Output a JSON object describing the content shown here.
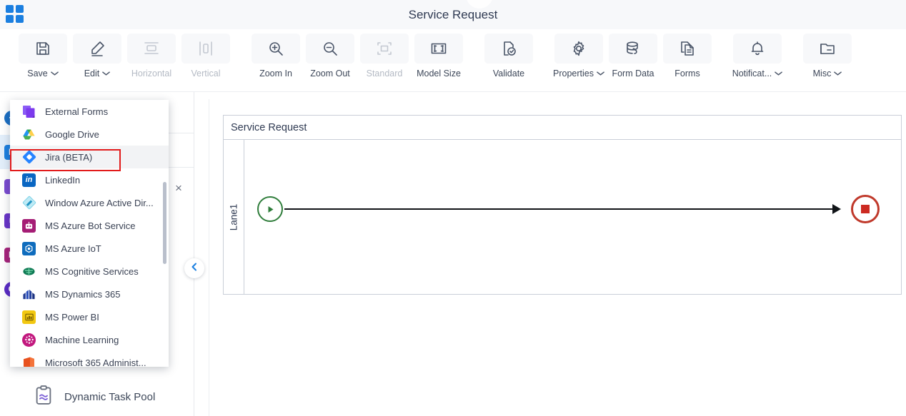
{
  "window": {
    "title": "Service Request",
    "app_icon": "grid-apps-icon"
  },
  "toolbar": {
    "items": [
      {
        "label": "Save",
        "icon": "save-icon",
        "caret": true,
        "disabled": false
      },
      {
        "label": "Edit",
        "icon": "pencil-icon",
        "caret": true,
        "disabled": false
      },
      {
        "label": "Horizontal",
        "icon": "horizontal-icon",
        "caret": false,
        "disabled": true
      },
      {
        "label": "Vertical",
        "icon": "vertical-icon",
        "caret": false,
        "disabled": true
      },
      {
        "label": "Zoom In",
        "icon": "zoom-in-icon",
        "caret": false,
        "disabled": false
      },
      {
        "label": "Zoom Out",
        "icon": "zoom-out-icon",
        "caret": false,
        "disabled": false
      },
      {
        "label": "Standard",
        "icon": "standard-icon",
        "caret": false,
        "disabled": true
      },
      {
        "label": "Model Size",
        "icon": "model-size-icon",
        "caret": false,
        "disabled": false
      },
      {
        "label": "Validate",
        "icon": "validate-icon",
        "caret": false,
        "disabled": false
      },
      {
        "label": "Properties",
        "icon": "gear-icon",
        "caret": true,
        "disabled": false
      },
      {
        "label": "Form Data",
        "icon": "database-icon",
        "caret": false,
        "disabled": false
      },
      {
        "label": "Forms",
        "icon": "forms-icon",
        "caret": false,
        "disabled": false
      },
      {
        "label": "Notificat...",
        "icon": "bell-icon",
        "caret": true,
        "disabled": false
      },
      {
        "label": "Misc",
        "icon": "folder-icon",
        "caret": true,
        "disabled": false
      }
    ]
  },
  "dropdown": {
    "highlighted_index": 2,
    "highlight_color": "#e21b1b",
    "items": [
      {
        "label": "External Forms",
        "icon": "external-forms-icon",
        "color": "#7b4bd1"
      },
      {
        "label": "Google Drive",
        "icon": "google-drive-icon",
        "color": "#1aa260"
      },
      {
        "label": "Jira (BETA)",
        "icon": "jira-icon",
        "color": "#2684ff"
      },
      {
        "label": "LinkedIn",
        "icon": "linkedin-icon",
        "color": "#0a66c2"
      },
      {
        "label": "Window Azure Active Dir...",
        "icon": "azure-active-directory-icon",
        "color": "#6fd3e8"
      },
      {
        "label": "MS Azure Bot Service",
        "icon": "azure-bot-service-icon",
        "color": "#a51d75"
      },
      {
        "label": "MS Azure IoT",
        "icon": "azure-iot-icon",
        "color": "#0f6cbd"
      },
      {
        "label": "MS Cognitive Services",
        "icon": "cognitive-services-icon",
        "color": "#0f7a54"
      },
      {
        "label": "MS Dynamics 365",
        "icon": "dynamics-365-icon",
        "color": "#2b3a8f"
      },
      {
        "label": "MS Power BI",
        "icon": "power-bi-icon",
        "color": "#f2c811"
      },
      {
        "label": "Machine Learning",
        "icon": "machine-learning-icon",
        "color": "#c2187e"
      },
      {
        "label": "Microsoft 365 Administ...",
        "icon": "microsoft-365-icon",
        "color": "#e8521f"
      }
    ]
  },
  "left_panel": {
    "close_label": "×",
    "collapse_icon": "chevron-left-icon",
    "bottom_item": {
      "label": "Dynamic Task Pool",
      "icon": "clipboard-task-icon"
    }
  },
  "rail": {
    "items": [
      {
        "icon": "rail-icon-1",
        "color": "#1b6fc4",
        "glyph": "⊕",
        "shape": "circ",
        "active": false
      },
      {
        "icon": "rail-icon-2",
        "color": "#1b7fe0",
        "glyph": "E",
        "shape": "sq",
        "active": true
      },
      {
        "icon": "rail-icon-3",
        "color": "#7b4bd1",
        "glyph": "I",
        "shape": "sq",
        "active": false
      },
      {
        "icon": "rail-icon-4",
        "color": "#6a35c9",
        "glyph": "≡",
        "shape": "sq",
        "active": false
      },
      {
        "icon": "rail-icon-5",
        "color": "#a8247c",
        "glyph": "E",
        "shape": "sq",
        "active": false
      },
      {
        "icon": "rail-icon-6",
        "color": "#5b2bc6",
        "glyph": "C",
        "shape": "circ",
        "active": false
      }
    ]
  },
  "canvas": {
    "pool_title": "Service Request",
    "lane_label": "Lane1",
    "start_event": {
      "name": "start-event",
      "color": "#2f7d3b"
    },
    "end_event": {
      "name": "end-event",
      "color": "#c0392b"
    }
  }
}
